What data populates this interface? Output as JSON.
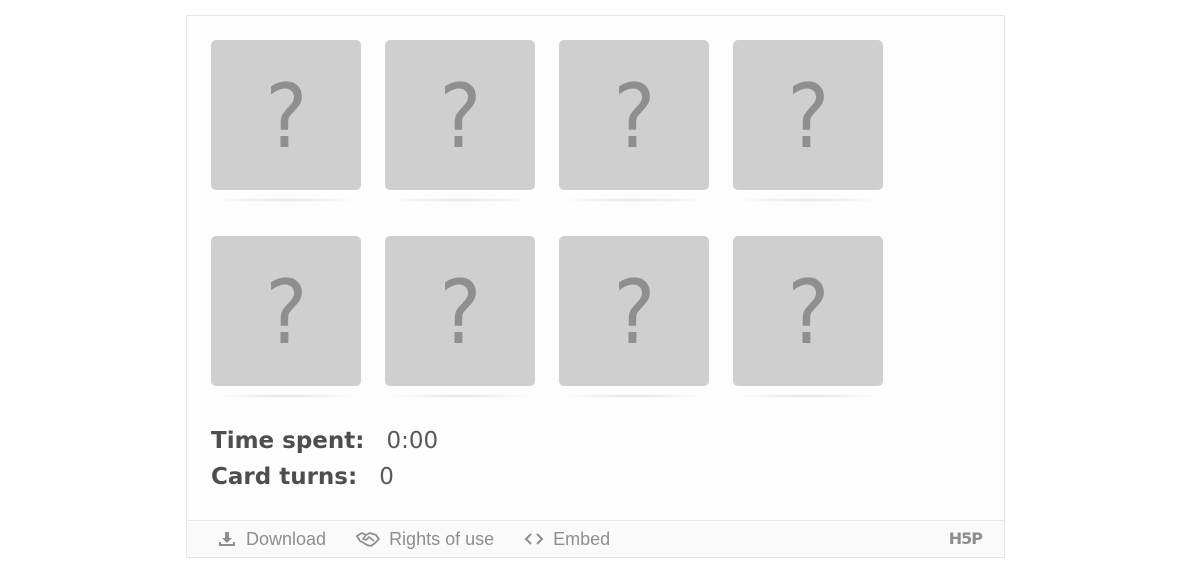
{
  "cards": [
    {
      "face": "?"
    },
    {
      "face": "?"
    },
    {
      "face": "?"
    },
    {
      "face": "?"
    },
    {
      "face": "?"
    },
    {
      "face": "?"
    },
    {
      "face": "?"
    },
    {
      "face": "?"
    }
  ],
  "stats": {
    "time_label": "Time spent:",
    "time_value": "0:00",
    "turns_label": "Card turns:",
    "turns_value": "0"
  },
  "footer": {
    "download_label": "Download",
    "download_icon": "download-icon",
    "rights_label": "Rights of use",
    "rights_icon": "handshake-icon",
    "embed_label": "Embed",
    "embed_icon": "code-icon",
    "logo_text": "H5P"
  },
  "colors": {
    "card_back": "#cfcfcf",
    "card_glyph": "#8f8f8f",
    "text": "#545454",
    "footer_text": "#8e8e8e"
  }
}
